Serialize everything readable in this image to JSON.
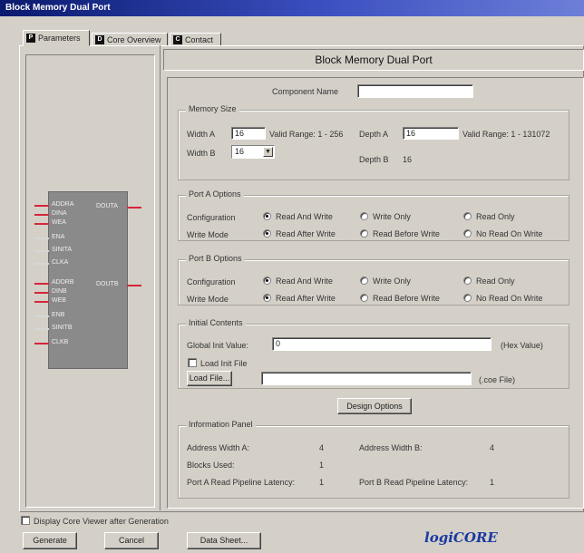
{
  "window": {
    "title": "Block Memory Dual Port"
  },
  "tabs": [
    {
      "label": "Parameters",
      "icon": "P"
    },
    {
      "label": "Core Overview",
      "icon": "D"
    },
    {
      "label": "Contact",
      "icon": "C"
    }
  ],
  "header": {
    "title": "Block Memory Dual Port"
  },
  "component_name": {
    "label": "Component Name",
    "value": ""
  },
  "memory_size": {
    "legend": "Memory Size",
    "width_a": {
      "label": "Width A",
      "value": "16",
      "range": "Valid Range: 1 - 256"
    },
    "width_b": {
      "label": "Width B",
      "value": "16"
    },
    "depth_a": {
      "label": "Depth A",
      "value": "16",
      "range": "Valid Range: 1 - 131072"
    },
    "depth_b": {
      "label": "Depth B",
      "value": "16"
    }
  },
  "port_a": {
    "legend": "Port A Options",
    "configuration_label": "Configuration",
    "configuration_options": [
      "Read And Write",
      "Write Only",
      "Read Only"
    ],
    "write_mode_label": "Write Mode",
    "write_mode_options": [
      "Read After Write",
      "Read Before Write",
      "No Read On Write"
    ]
  },
  "port_b": {
    "legend": "Port B Options",
    "configuration_label": "Configuration",
    "configuration_options": [
      "Read And Write",
      "Write Only",
      "Read Only"
    ],
    "write_mode_label": "Write Mode",
    "write_mode_options": [
      "Read After Write",
      "Read Before Write",
      "No Read On Write"
    ]
  },
  "initial_contents": {
    "legend": "Initial Contents",
    "global_init_label": "Global Init Value:",
    "global_init_value": "0",
    "hex_suffix": "(Hex Value)",
    "load_init_label": "Load Init File",
    "load_button": "Load File...",
    "file_path": "",
    "load_suffix": "(.coe File)"
  },
  "design_options_button": "Design Options",
  "info_panel": {
    "legend": "Information Panel",
    "address_width_a": {
      "label": "Address Width A:",
      "value": "4"
    },
    "address_width_b": {
      "label": "Address Width B:",
      "value": "4"
    },
    "blocks_used": {
      "label": "Blocks Used:",
      "value": "1"
    },
    "port_a_latency": {
      "label": "Port A Read Pipeline Latency:",
      "value": "1"
    },
    "port_b_latency": {
      "label": "Port B Read Pipeline Latency:",
      "value": "1"
    }
  },
  "footer": {
    "display_core_viewer": "Display Core Viewer after Generation",
    "generate_button": "Generate",
    "cancel_button": "Cancel",
    "data_sheet_button": "Data Sheet...",
    "logo": "logiCORE"
  },
  "symbol": {
    "pins_left": [
      "ADDRA",
      "DINA",
      "WEA",
      "ENA",
      "SINITA",
      "CLKA",
      "ADDRB",
      "DINB",
      "WEB",
      "ENB",
      "SINITB",
      "CLKB"
    ],
    "pins_right": [
      "DOUTA",
      "DOUTB"
    ]
  },
  "colors": {
    "titlebar": "#0a1a6e",
    "face": "#d4d0c8",
    "pin_red": "#d5263a",
    "logo_blue": "#1a3aa0",
    "logo_red": "#e0303a"
  }
}
